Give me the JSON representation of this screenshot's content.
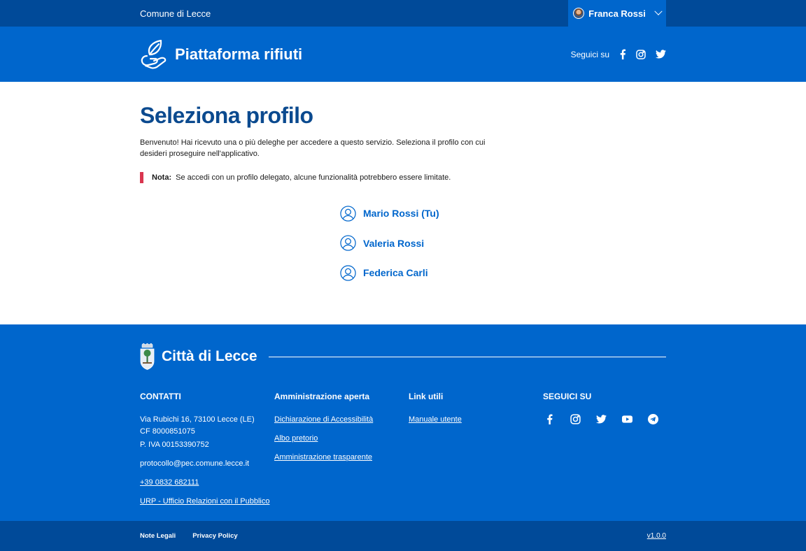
{
  "slim_header": {
    "ente_label": "Comune di Lecce",
    "user_name": "Franca Rossi"
  },
  "center_header": {
    "title": "Piattaforma rifiuti",
    "social_label": "Seguici su",
    "social_icons": [
      "facebook-icon",
      "instagram-icon",
      "twitter-icon"
    ]
  },
  "main": {
    "title": "Seleziona profilo",
    "intro": "Benvenuto! Hai ricevuto una o più deleghe per accedere a questo servizio. Seleziona il profilo con cui desideri proseguire nell'applicativo.",
    "note_label": "Nota:",
    "note_text": "Se accedi con un profilo delegato, alcune funzionalità potrebbero essere limitate.",
    "profiles": [
      {
        "label": "Mario Rossi (Tu)"
      },
      {
        "label": "Valeria Rossi"
      },
      {
        "label": "Federica Carli"
      }
    ]
  },
  "footer": {
    "brand": "Città di Lecce",
    "contacts": {
      "heading": "CONTATTI",
      "address": "Via Rubichi 16, 73100 Lecce (LE)",
      "cf": "CF 8000851075",
      "piva": "P. IVA 00153390752",
      "pec": "protocollo@pec.comune.lecce.it",
      "phone": "+39 0832 682111",
      "urp": "URP - Ufficio Relazioni con il Pubblico"
    },
    "admin": {
      "heading": "Amministrazione aperta",
      "links": [
        "Dichiarazione di Accessibilità",
        "Albo pretorio",
        "Amministrazione trasparente"
      ]
    },
    "useful": {
      "heading": "Link utili",
      "links": [
        "Manuale utente"
      ]
    },
    "follow": {
      "heading": "SEGUICI SU",
      "icons": [
        "facebook-icon",
        "instagram-icon",
        "twitter-icon",
        "youtube-icon",
        "telegram-icon"
      ]
    },
    "bottom": {
      "legal": "Note Legali",
      "privacy": "Privacy Policy",
      "version": "v1.0.0"
    }
  },
  "colors": {
    "primary": "#0066cc",
    "dark": "#004a99",
    "title": "#0b4a8f",
    "note_bar": "#d9364f"
  }
}
